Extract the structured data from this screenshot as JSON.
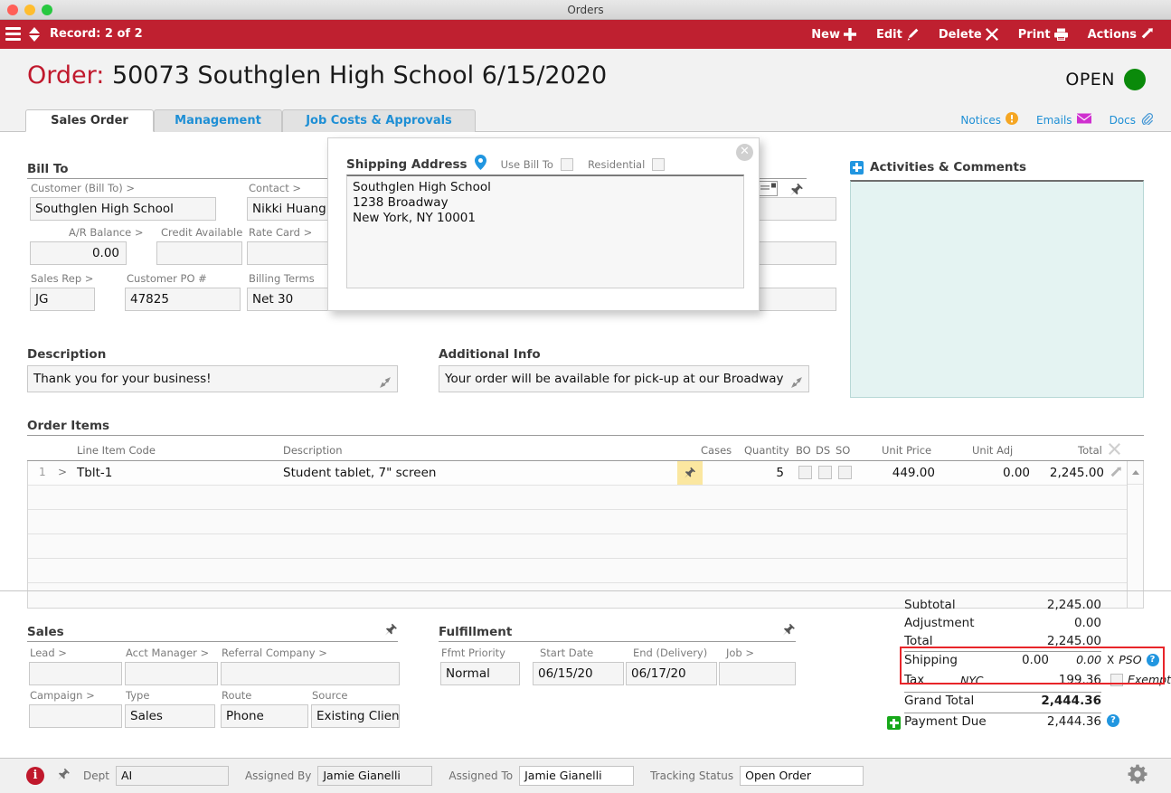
{
  "window": {
    "title": "Orders"
  },
  "toolbar": {
    "record_label": "Record: 2 of 2",
    "buttons": [
      {
        "label": "New",
        "icon": "plus-icon"
      },
      {
        "label": "Edit",
        "icon": "pencil-icon"
      },
      {
        "label": "Delete",
        "icon": "x-icon"
      },
      {
        "label": "Print",
        "icon": "printer-icon"
      },
      {
        "label": "Actions",
        "icon": "arrow-out-icon"
      }
    ]
  },
  "order_header": {
    "label": "Order:",
    "value": "50073 Southglen High School  6/15/2020",
    "status_text": "OPEN",
    "status_color": "#0a8a0a"
  },
  "tabs": [
    {
      "label": "Sales Order",
      "active": true
    },
    {
      "label": "Management",
      "active": false
    },
    {
      "label": "Job Costs & Approvals",
      "active": false
    }
  ],
  "top_links": [
    {
      "label": "Notices",
      "icon": "warning-icon"
    },
    {
      "label": "Emails",
      "icon": "envelope-icon"
    },
    {
      "label": "Docs",
      "icon": "paperclip-icon"
    }
  ],
  "bill_to": {
    "title": "Bill To",
    "customer_label": "Customer (Bill To) >",
    "customer_value": "Southglen High School",
    "contact_label": "Contact >",
    "contact_value": "Nikki Huang",
    "ar_balance_label": "A/R Balance >",
    "ar_balance_value": "0.00",
    "credit_available_label": "Credit Available",
    "credit_available_value": "",
    "rate_card_label": "Rate Card >",
    "rate_card_value": "",
    "sales_rep_label": "Sales Rep >",
    "sales_rep_value": "JG",
    "customer_po_label": "Customer PO #",
    "customer_po_value": "47825",
    "billing_terms_label": "Billing Terms",
    "billing_terms_value": "Net 30"
  },
  "shipping_popup": {
    "title": "Shipping Address",
    "pin_icon": "map-pin-icon",
    "use_bill_to_label": "Use Bill To",
    "residential_label": "Residential",
    "address": "Southglen High School\n1238 Broadway\nNew York, NY 10001",
    "close_label": "✕"
  },
  "activities": {
    "title": "Activities & Comments",
    "body": ""
  },
  "description": {
    "title": "Description",
    "value": "Thank you for your business!"
  },
  "additional_info": {
    "title": "Additional Info",
    "value": "Your order will be available for pick-up at our Broadway"
  },
  "order_items": {
    "title": "Order Items",
    "columns": [
      "Line Item Code",
      "Description",
      "Cases",
      "Quantity",
      "BO",
      "DS",
      "SO",
      "Unit Price",
      "Unit Adj",
      "Total"
    ],
    "rows": [
      {
        "index": "1",
        "chevron": ">",
        "code": "Tblt-1",
        "description": "Student tablet, 7\" screen",
        "cases": "",
        "quantity": "5",
        "unit_price": "449.00",
        "unit_adj": "0.00",
        "total": "2,245.00"
      }
    ],
    "empty_row_count": 5
  },
  "sales": {
    "title": "Sales",
    "lead_label": "Lead >",
    "lead_value": "",
    "acct_manager_label": "Acct Manager >",
    "acct_manager_value": "",
    "referral_company_label": "Referral Company >",
    "referral_company_value": "",
    "campaign_label": "Campaign >",
    "campaign_value": "",
    "type_label": "Type",
    "type_value": "Sales",
    "route_label": "Route",
    "route_value": "Phone",
    "source_label": "Source",
    "source_value": "Existing Client"
  },
  "fulfillment": {
    "title": "Fulfillment",
    "priority_label": "Ffmt Priority",
    "priority_value": "Normal",
    "start_date_label": "Start Date",
    "start_date_value": "06/15/20",
    "end_date_label": "End (Delivery)",
    "end_date_value": "06/17/20",
    "job_label": "Job >",
    "job_value": ""
  },
  "totals": {
    "subtotal_label": "Subtotal",
    "subtotal_value": "2,245.00",
    "adjustment_label": "Adjustment",
    "adjustment_value": "0.00",
    "total_label": "Total",
    "total_value": "2,245.00",
    "shipping_label": "Shipping",
    "shipping_value": "0.00",
    "shipping_value2": "0.00",
    "shipping_x": "X",
    "shipping_pso": "PSO",
    "tax_label": "Tax",
    "tax_jurisdiction": "NYC",
    "tax_value": "199.36",
    "tax_exempt_label": "Exempt",
    "grand_total_label": "Grand Total",
    "grand_total_value": "2,444.36",
    "payment_due_label": "Payment Due",
    "payment_due_value": "2,444.36",
    "highlight_color": "#e8252a"
  },
  "bottom_bar": {
    "dept_label": "Dept",
    "dept_value": "AI",
    "assigned_by_label": "Assigned By",
    "assigned_by_value": "Jamie Gianelli",
    "assigned_to_label": "Assigned To",
    "assigned_to_value": "Jamie Gianelli",
    "tracking_status_label": "Tracking Status",
    "tracking_status_value": "Open Order"
  }
}
